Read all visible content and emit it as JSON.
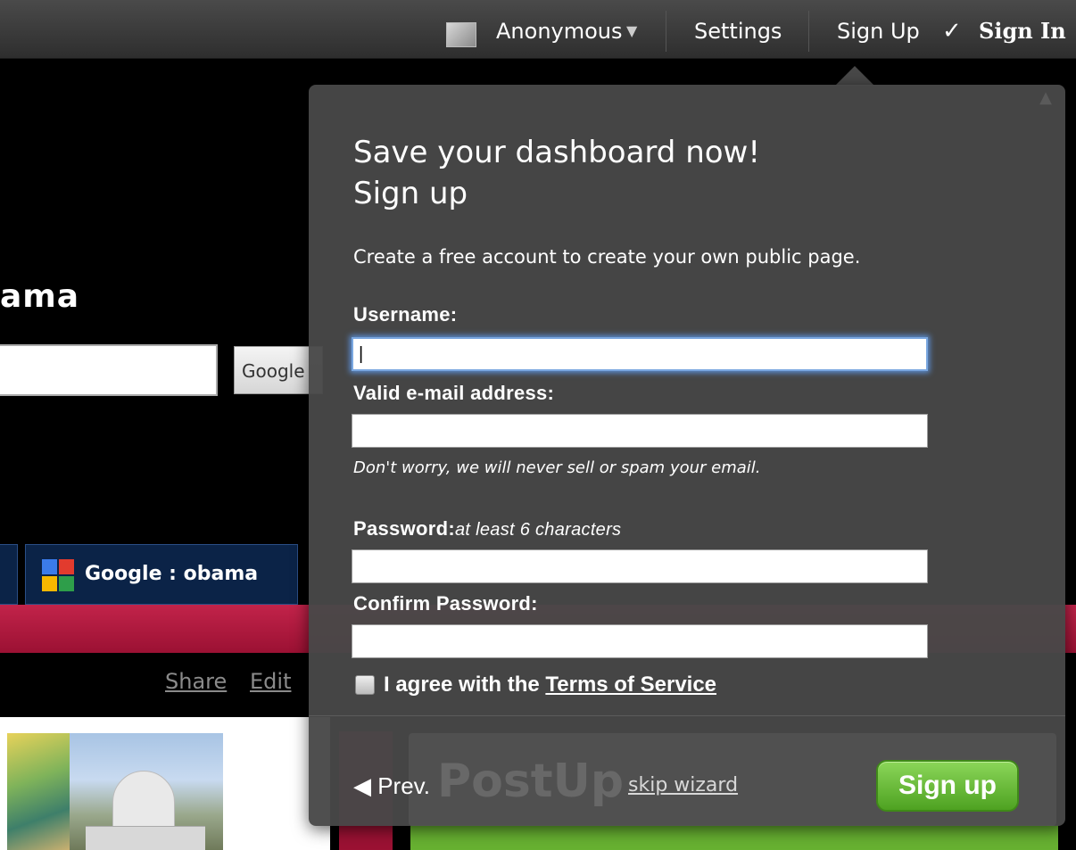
{
  "topbar": {
    "user_label": "Anonymous",
    "caret": "▼",
    "settings": "Settings",
    "signup": "Sign Up",
    "check": "✓",
    "signin": "Sign In"
  },
  "background": {
    "title_fragment": "ama",
    "search_button": "Google",
    "tab_label": "Google : obama",
    "share": "Share",
    "edit": "Edit",
    "ghost_text": "PostUp"
  },
  "popup": {
    "heading_line1": "Save your dashboard now!",
    "heading_line2": "Sign up",
    "subtitle": "Create a free account to create your own public page.",
    "username_label": "Username:",
    "username_value": "|",
    "email_label": "Valid e-mail address:",
    "email_value": "",
    "email_note": "Don't worry, we will never sell or spam your email.",
    "password_label": "Password:",
    "password_hint": "at least 6 characters",
    "password_value": "",
    "confirm_label": "Confirm Password:",
    "confirm_value": "",
    "agree_prefix": "I agree with the ",
    "agree_link": "Terms of Service",
    "prev": "◀ Prev.",
    "skip": "skip wizard",
    "signup_button": "Sign up",
    "close": "▲"
  },
  "colors": {
    "accent_green": "#4ea221",
    "stripe_red": "#c2234a",
    "tab_navy": "#0b2347",
    "popup_bg": "#484848"
  }
}
